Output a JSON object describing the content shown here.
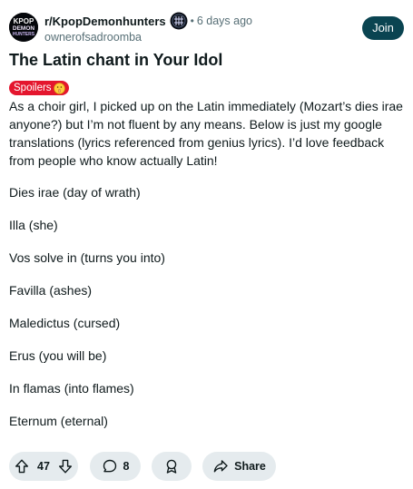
{
  "header": {
    "subreddit": "r/KpopDemonhunters",
    "separator": "•",
    "time_ago": "6 days ago",
    "username": "ownerofsadroomba",
    "join_label": "Join",
    "avatar_text": [
      "KPOP",
      "DEMON",
      "HUNTERS"
    ]
  },
  "post": {
    "title": "The Latin chant in Your Idol",
    "flair": "Spoilers",
    "intro": "As a choir girl, I picked up on the Latin immediately (Mozart’s dies irae anyone?) but I’m not fluent by any means. Below is just my google translations (lyrics referenced from genius lyrics). I’d love feedback from people who know actually Latin!",
    "lyrics": [
      "Dies irae (day of wrath)",
      "Illa (she)",
      "Vos solve in (turns you into)",
      "Favilla (ashes)",
      "Maledictus (cursed)",
      "Erus (you will be)",
      "In flamas (into flames)",
      "Eternum (eternal)"
    ]
  },
  "actions": {
    "score": "47",
    "comments": "8",
    "share_label": "Share"
  },
  "colors": {
    "join_bg": "#0a4451",
    "flair_bg": "#e4162e",
    "pill_bg": "#e5ebee",
    "muted_text": "#576f76"
  },
  "icons": {
    "avatar": "kpop-demon-hunters-logo",
    "subreddit_badge": "subreddit-badge-icon",
    "flair": "shushing-face-emoji",
    "upvote": "upvote-arrow-icon",
    "downvote": "downvote-arrow-icon",
    "comments": "comment-bubble-icon",
    "award": "award-ribbon-icon",
    "share": "share-arrow-icon"
  }
}
